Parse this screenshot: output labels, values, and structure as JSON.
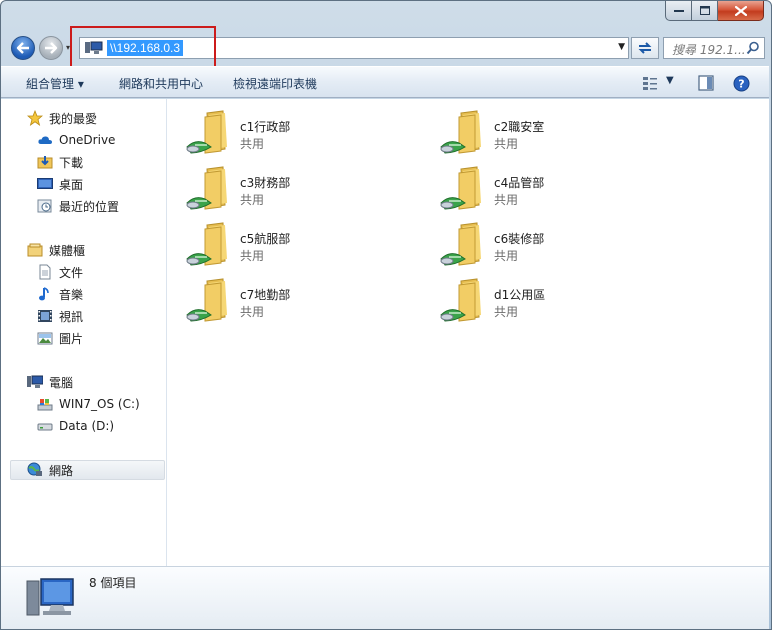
{
  "address": {
    "path": "\\\\192.168.0.3"
  },
  "search": {
    "placeholder": "搜尋 192.1..."
  },
  "commands": {
    "organize": "組合管理 ▾",
    "network_center": "網路和共用中心",
    "view_printers": "檢視遠端印表機"
  },
  "nav": {
    "favorites": "我的最愛",
    "onedrive": "OneDrive",
    "downloads": "下載",
    "desktop": "桌面",
    "recent": "最近的位置",
    "libraries": "媒體櫃",
    "documents": "文件",
    "music": "音樂",
    "videos": "視訊",
    "pictures": "圖片",
    "computer": "電腦",
    "drive_c": "WIN7_OS (C:)",
    "drive_d": "Data (D:)",
    "network": "網路"
  },
  "shares": [
    {
      "name": "c1行政部",
      "type": "共用"
    },
    {
      "name": "c2職安室",
      "type": "共用"
    },
    {
      "name": "c3財務部",
      "type": "共用"
    },
    {
      "name": "c4品管部",
      "type": "共用"
    },
    {
      "name": "c5航服部",
      "type": "共用"
    },
    {
      "name": "c6裝修部",
      "type": "共用"
    },
    {
      "name": "c7地勤部",
      "type": "共用"
    },
    {
      "name": "d1公用區",
      "type": "共用"
    }
  ],
  "details": {
    "count": "8 個項目"
  },
  "colors": {
    "accent": "#3399ff",
    "highlight_box": "#cc1b1b",
    "folder": "#f2cd65",
    "share_green": "#3aa34a"
  }
}
